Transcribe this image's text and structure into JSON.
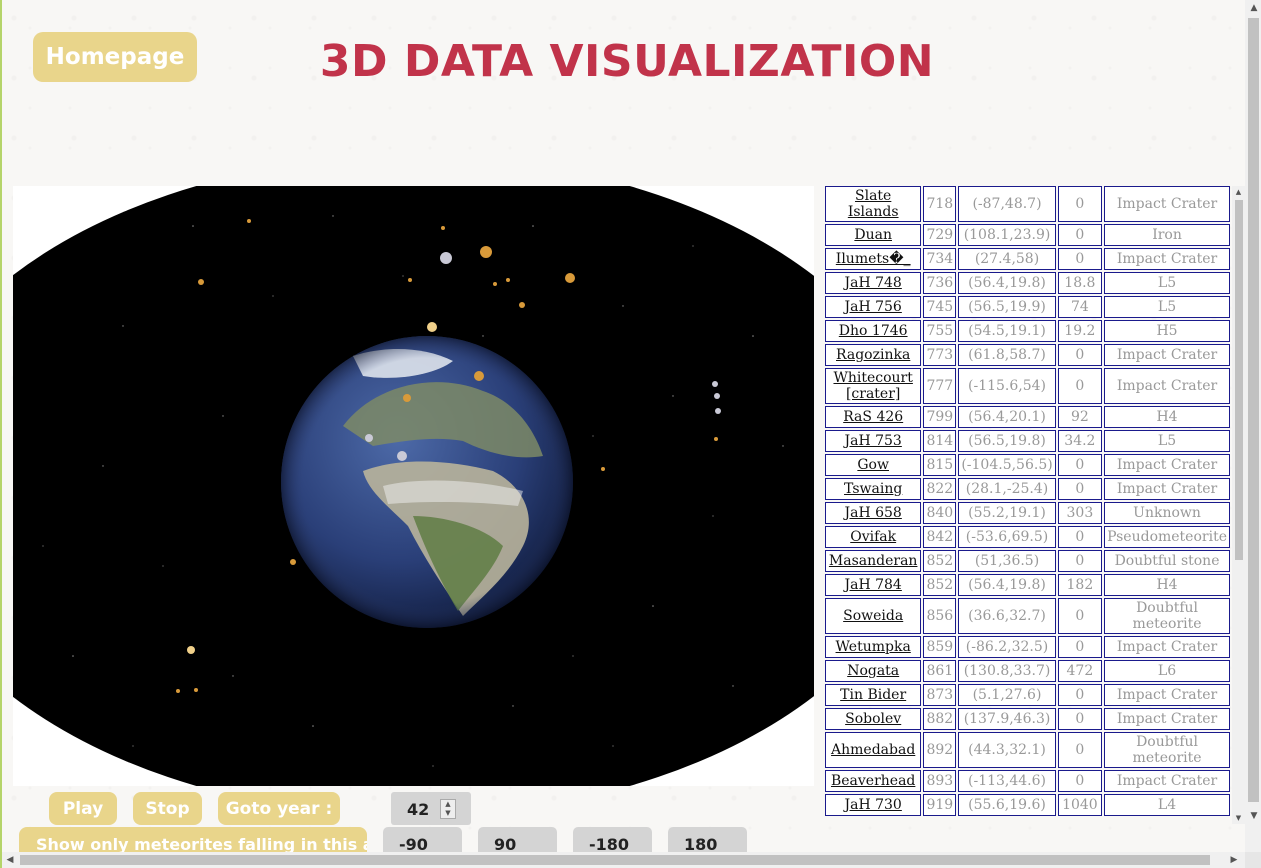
{
  "header": {
    "home_label": "Homepage",
    "title": "3D DATA VISUALIZATION"
  },
  "controls": {
    "play_label": "Play",
    "stop_label": "Stop",
    "goto_label": "Goto year :",
    "year_value": "42",
    "area_label": "Show only meteorites falling in this area :",
    "area_bounds": [
      "-90",
      "90",
      "-180",
      "180"
    ]
  },
  "visualization": {
    "scene": "earth-globe-with-meteorite-markers",
    "background_color": "#000000"
  },
  "table": {
    "rows": [
      {
        "name": "Slate Islands",
        "year": "718",
        "coords": "(-87,48.7)",
        "mass": "0",
        "type": "Impact Crater"
      },
      {
        "name": "Duan",
        "year": "729",
        "coords": "(108.1,23.9)",
        "mass": "0",
        "type": "Iron"
      },
      {
        "name": "Ilumets�_",
        "year": "734",
        "coords": "(27.4,58)",
        "mass": "0",
        "type": "Impact Crater"
      },
      {
        "name": "JaH 748",
        "year": "736",
        "coords": "(56.4,19.8)",
        "mass": "18.8",
        "type": "L5"
      },
      {
        "name": "JaH 756",
        "year": "745",
        "coords": "(56.5,19.9)",
        "mass": "74",
        "type": "L5"
      },
      {
        "name": "Dho 1746",
        "year": "755",
        "coords": "(54.5,19.1)",
        "mass": "19.2",
        "type": "H5"
      },
      {
        "name": "Ragozinka",
        "year": "773",
        "coords": "(61.8,58.7)",
        "mass": "0",
        "type": "Impact Crater"
      },
      {
        "name": "Whitecourt [crater]",
        "year": "777",
        "coords": "(-115.6,54)",
        "mass": "0",
        "type": "Impact Crater",
        "tall": true
      },
      {
        "name": "RaS 426",
        "year": "799",
        "coords": "(56.4,20.1)",
        "mass": "92",
        "type": "H4"
      },
      {
        "name": "JaH 753",
        "year": "814",
        "coords": "(56.5,19.8)",
        "mass": "34.2",
        "type": "L5"
      },
      {
        "name": "Gow",
        "year": "815",
        "coords": "(-104.5,56.5)",
        "mass": "0",
        "type": "Impact Crater"
      },
      {
        "name": "Tswaing",
        "year": "822",
        "coords": "(28.1,-25.4)",
        "mass": "0",
        "type": "Impact Crater"
      },
      {
        "name": "JaH 658",
        "year": "840",
        "coords": "(55.2,19.1)",
        "mass": "303",
        "type": "Unknown"
      },
      {
        "name": "Ovifak",
        "year": "842",
        "coords": "(-53.6,69.5)",
        "mass": "0",
        "type": "Pseudometeorite"
      },
      {
        "name": "Masanderan",
        "year": "852",
        "coords": "(51,36.5)",
        "mass": "0",
        "type": "Doubtful stone"
      },
      {
        "name": "JaH 784",
        "year": "852",
        "coords": "(56.4,19.8)",
        "mass": "182",
        "type": "H4"
      },
      {
        "name": "Soweida",
        "year": "856",
        "coords": "(36.6,32.7)",
        "mass": "0",
        "type": "Doubtful meteorite",
        "tall": true
      },
      {
        "name": "Wetumpka",
        "year": "859",
        "coords": "(-86.2,32.5)",
        "mass": "0",
        "type": "Impact Crater"
      },
      {
        "name": "Nogata",
        "year": "861",
        "coords": "(130.8,33.7)",
        "mass": "472",
        "type": "L6"
      },
      {
        "name": "Tin Bider",
        "year": "873",
        "coords": "(5.1,27.6)",
        "mass": "0",
        "type": "Impact Crater"
      },
      {
        "name": "Sobolev",
        "year": "882",
        "coords": "(137.9,46.3)",
        "mass": "0",
        "type": "Impact Crater"
      },
      {
        "name": "Ahmedabad",
        "year": "892",
        "coords": "(44.3,32.1)",
        "mass": "0",
        "type": "Doubtful meteorite",
        "tall": true
      },
      {
        "name": "Beaverhead",
        "year": "893",
        "coords": "(-113,44.6)",
        "mass": "0",
        "type": "Impact Crater"
      },
      {
        "name": "JaH 730",
        "year": "919",
        "coords": "(55.6,19.6)",
        "mass": "1040",
        "type": "L4"
      }
    ]
  },
  "colors": {
    "accent_button": "#e9d58b",
    "title": "#c1334a",
    "table_border": "#1a1a8c"
  }
}
